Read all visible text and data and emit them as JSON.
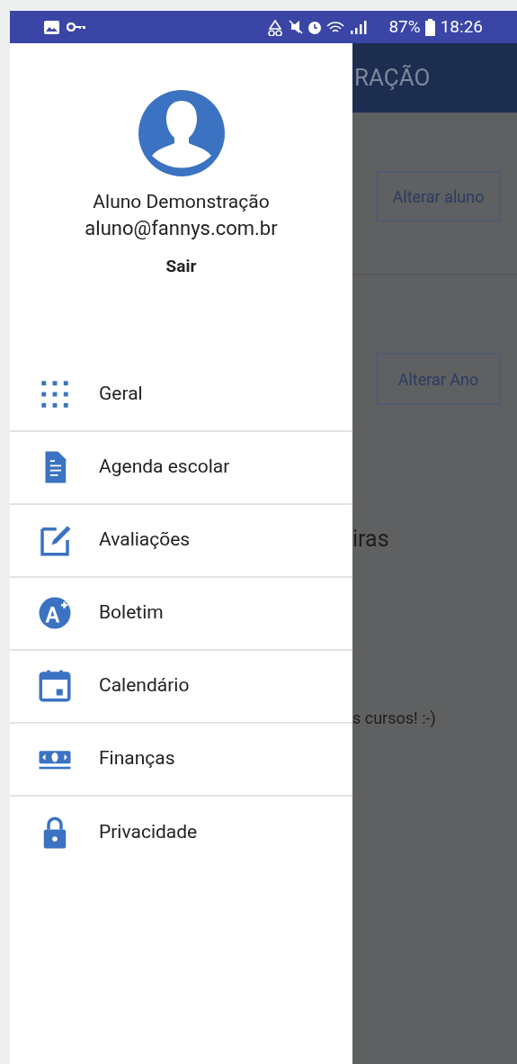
{
  "status_bar": {
    "battery": "87%",
    "time": "18:26"
  },
  "drawer": {
    "user_name": "Aluno Demonstração",
    "user_email": "aluno@fannys.com.br",
    "logout": "Sair",
    "items": [
      {
        "label": "Geral",
        "kind": "grid"
      },
      {
        "label": "Agenda escolar",
        "kind": "document"
      },
      {
        "label": "Avaliações",
        "kind": "edit"
      },
      {
        "label": "Boletim",
        "kind": "grade"
      },
      {
        "label": "Calendário",
        "kind": "calendar"
      },
      {
        "label": "Finanças",
        "kind": "money"
      },
      {
        "label": "Privacidade",
        "kind": "lock"
      }
    ]
  },
  "background": {
    "app_bar_title": "RAÇÃO",
    "buttons": [
      "Alterar aluno",
      "Alterar Ano"
    ],
    "heading": "iras",
    "texts": [
      "s cursos! :-)"
    ]
  }
}
